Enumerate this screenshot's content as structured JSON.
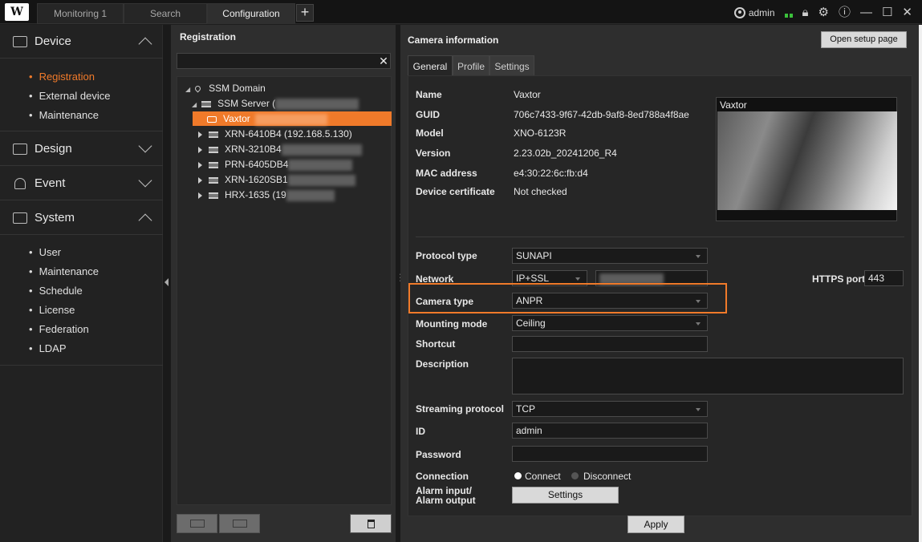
{
  "topbar": {
    "logo": "W",
    "tabs": [
      {
        "label": "Monitoring 1"
      },
      {
        "label": "Search"
      },
      {
        "label": "Configuration"
      }
    ],
    "add_tab": "+",
    "user": "admin"
  },
  "nav": {
    "device": "Device",
    "device_items": [
      "Registration",
      "External device",
      "Maintenance"
    ],
    "design": "Design",
    "event": "Event",
    "system": "System",
    "system_items": [
      "User",
      "Maintenance",
      "Schedule",
      "License",
      "Federation",
      "LDAP"
    ]
  },
  "registration": {
    "title": "Registration",
    "search_value": "",
    "tree": {
      "domain": "SSM Domain",
      "server": "SSM Server (",
      "selected": "Vaxtor",
      "devices": [
        "XRN-6410B4 (192.168.5.130)",
        "XRN-3210B4",
        "PRN-6405DB4",
        "XRN-1620SB1",
        "HRX-1635 (19"
      ]
    }
  },
  "camera": {
    "title": "Camera information",
    "open_setup": "Open setup page",
    "tabs": [
      "General",
      "Profile",
      "Settings"
    ],
    "labels": {
      "name": "Name",
      "guid": "GUID",
      "model": "Model",
      "version": "Version",
      "mac": "MAC address",
      "cert": "Device certificate",
      "protocol": "Protocol type",
      "network": "Network",
      "https_port": "HTTPS port",
      "camera_type": "Camera type",
      "mounting": "Mounting mode",
      "shortcut": "Shortcut",
      "description": "Description",
      "streaming": "Streaming protocol",
      "id": "ID",
      "password": "Password",
      "connection": "Connection",
      "alarm1": "Alarm input/",
      "alarm2": "Alarm output"
    },
    "values": {
      "name": "Vaxtor",
      "guid": "706c7433-9f67-42db-9af8-8ed788a4f8ae",
      "model": "XNO-6123R",
      "version": "2.23.02b_20241206_R4",
      "mac": "e4:30:22:6c:fb:d4",
      "cert": "Not checked",
      "protocol": "SUNAPI",
      "network": "IP+SSL",
      "https_port": "443",
      "camera_type": "ANPR",
      "mounting": "Ceiling",
      "shortcut": "",
      "description": "",
      "streaming": "TCP",
      "id": "admin",
      "password": ""
    },
    "preview_title": "Vaxtor",
    "connect": "Connect",
    "disconnect": "Disconnect",
    "settings_btn": "Settings",
    "apply": "Apply"
  },
  "colors": {
    "accent": "#f07a2a",
    "status": "#3bc13b"
  }
}
